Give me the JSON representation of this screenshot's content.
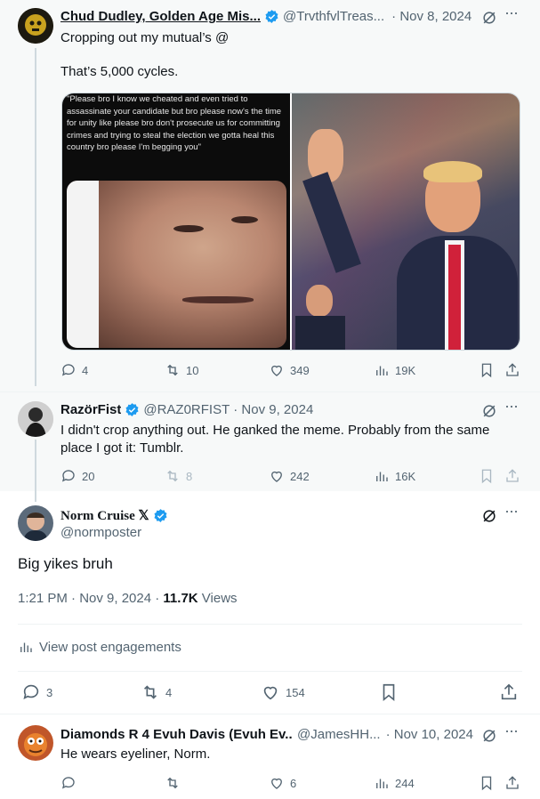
{
  "post1": {
    "name": "Chud Dudley, Golden Age Mis...",
    "handle": "@TrvthfvlTreas...",
    "date": "· Nov 8, 2024",
    "text_line1": "Cropping out my mutual’s @",
    "text_line2": "That’s 5,000 cycles.",
    "image_caption": "\"Please bro I know we cheated and even tried to assassinate your candidate but bro please now's the time for unity like please bro don't prosecute us for committing crimes and trying to steal the election we gotta heal this country bro please I'm begging you\"",
    "replies": "4",
    "reposts": "10",
    "likes": "349",
    "views": "19K"
  },
  "post2": {
    "name": "RazörFist",
    "handle": "@RAZ0RFIST",
    "date": "· Nov 9, 2024",
    "text": "I didn't crop anything out. He ganked the meme. Probably from the same place I got it: Tumblr.",
    "replies": "20",
    "reposts": "8",
    "likes": "242",
    "views": "16K"
  },
  "main": {
    "name": "Norm Cruise 𝕏",
    "handle": "@normposter",
    "text": "Big yikes bruh",
    "timestamp": "1:21 PM · Nov 9, 2024 · ",
    "views_count": "11.7K",
    "views_label": " Views",
    "engagements_label": "View post engagements",
    "replies": "3",
    "reposts": "4",
    "likes": "154"
  },
  "post3": {
    "name": "Diamonds R 4 Evuh Davis (Evuh Ev...",
    "handle": "@JamesHH...",
    "date": "· Nov 10, 2024",
    "text": "He wears eyeliner, Norm.",
    "replies": "",
    "reposts": "",
    "likes": "6",
    "views": "244"
  },
  "colors": {
    "verified": "#1d9bf0",
    "text": "#0f1419",
    "secondary": "#536471",
    "highlight_bg": "#f7f9f9"
  }
}
